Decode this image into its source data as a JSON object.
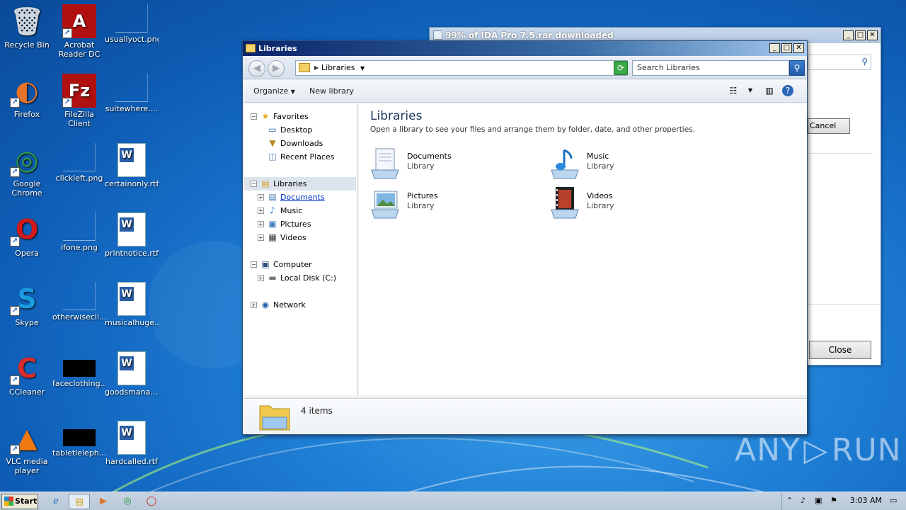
{
  "desktop": {
    "icons": [
      {
        "label": "Recycle Bin",
        "icon": "recycle-bin-icon"
      },
      {
        "label": "Acrobat Reader DC",
        "icon": "acrobat-icon"
      },
      {
        "label": "usuallyoct.png",
        "icon": "png-file-icon"
      },
      {
        "label": "Firefox",
        "icon": "firefox-icon"
      },
      {
        "label": "FileZilla Client",
        "icon": "filezilla-icon"
      },
      {
        "label": "suitewhere....",
        "icon": "file-icon"
      },
      {
        "label": "Google Chrome",
        "icon": "chrome-icon"
      },
      {
        "label": "clickleft.png",
        "icon": "png-file-icon"
      },
      {
        "label": "certainonly.rtf",
        "icon": "rtf-file-icon"
      },
      {
        "label": "Opera",
        "icon": "opera-icon"
      },
      {
        "label": "ifone.png",
        "icon": "png-file-icon"
      },
      {
        "label": "printnotice.rtf",
        "icon": "rtf-file-icon"
      },
      {
        "label": "Skype",
        "icon": "skype-icon"
      },
      {
        "label": "otherwisecli...",
        "icon": "png-file-icon"
      },
      {
        "label": "musicalhuge....",
        "icon": "rtf-file-icon"
      },
      {
        "label": "CCleaner",
        "icon": "ccleaner-icon"
      },
      {
        "label": "faceclothing....",
        "icon": "black-file-icon"
      },
      {
        "label": "goodsmana....",
        "icon": "rtf-file-icon"
      },
      {
        "label": "VLC media player",
        "icon": "vlc-icon"
      },
      {
        "label": "tabletleleph...",
        "icon": "black-file-icon"
      },
      {
        "label": "hardcalled.rtf",
        "icon": "rtf-file-icon"
      }
    ]
  },
  "bg_window": {
    "title": "99% of IDA Pro 7.5.rar downloaded",
    "cancel_label": "Cancel",
    "close_label": "Close"
  },
  "window": {
    "title": "Libraries",
    "address_crumb": "Libraries",
    "search_placeholder": "Search Libraries",
    "toolbar": {
      "organize": "Organize",
      "new_library": "New library"
    },
    "nav": {
      "favorites": "Favorites",
      "desktop": "Desktop",
      "downloads": "Downloads",
      "recent": "Recent Places",
      "libraries": "Libraries",
      "documents": "Documents",
      "music": "Music",
      "pictures": "Pictures",
      "videos": "Videos",
      "computer": "Computer",
      "local_disk": "Local Disk (C:)",
      "network": "Network"
    },
    "content": {
      "heading": "Libraries",
      "subtitle": "Open a library to see your files and arrange them by folder, date, and other properties.",
      "items": [
        {
          "name": "Documents",
          "type": "Library"
        },
        {
          "name": "Music",
          "type": "Library"
        },
        {
          "name": "Pictures",
          "type": "Library"
        },
        {
          "name": "Videos",
          "type": "Library"
        }
      ]
    },
    "details": {
      "count": "4 items"
    }
  },
  "taskbar": {
    "start_label": "Start",
    "clock": "3:03 AM"
  },
  "watermark": "ANY RUN"
}
